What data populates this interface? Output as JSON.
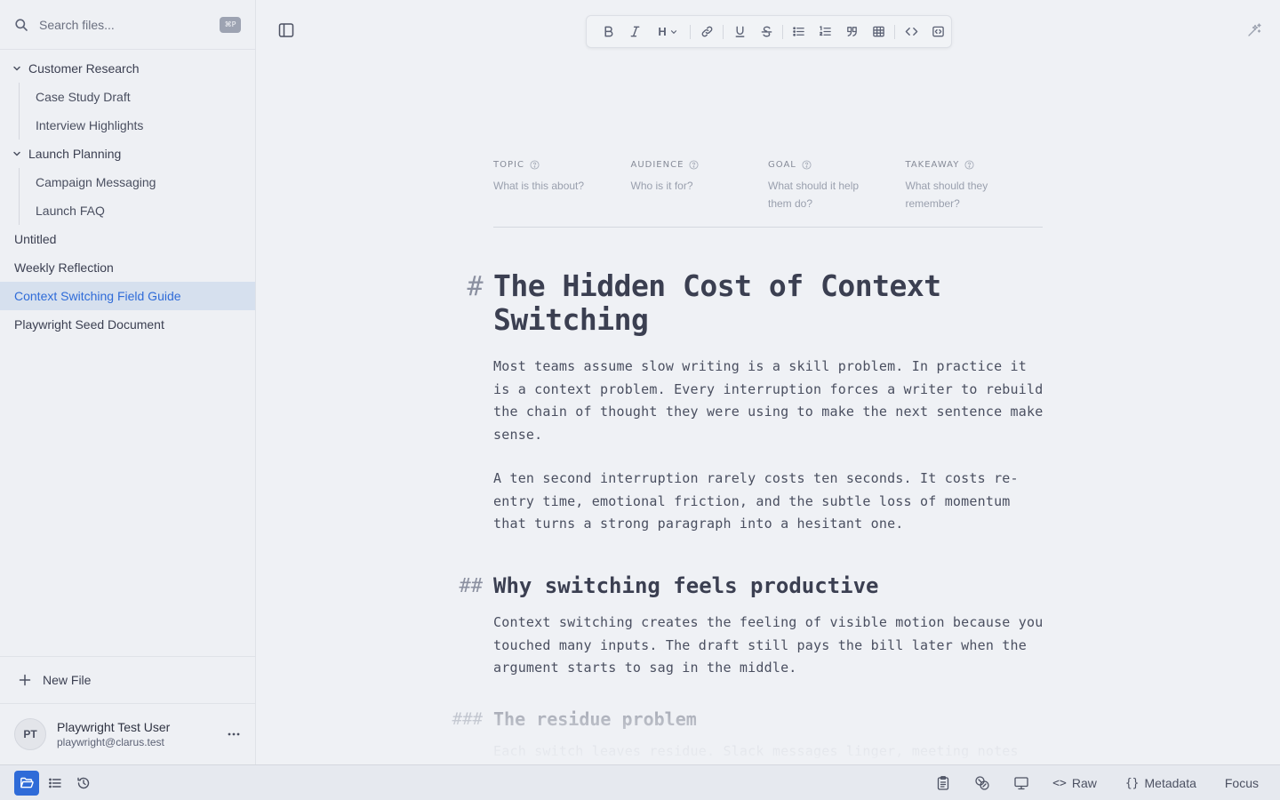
{
  "sidebar": {
    "search_placeholder": "Search files...",
    "search_shortcut": "⌘P",
    "folders": [
      {
        "label": "Customer Research",
        "children": [
          "Case Study Draft",
          "Interview Highlights"
        ]
      },
      {
        "label": "Launch Planning",
        "children": [
          "Campaign Messaging",
          "Launch FAQ"
        ]
      }
    ],
    "files": [
      "Untitled",
      "Weekly Reflection",
      "Context Switching Field Guide",
      "Playwright Seed Document"
    ],
    "active_file": "Context Switching Field Guide",
    "new_file_label": "New File",
    "user": {
      "initials": "PT",
      "name": "Playwright Test User",
      "email": "playwright@clarus.test"
    }
  },
  "toolbar": {
    "buttons": [
      "bold",
      "italic",
      "heading",
      "link",
      "underline",
      "strikethrough",
      "bullet-list",
      "ordered-list",
      "quote",
      "table",
      "code",
      "code-block"
    ],
    "heading_label": "H"
  },
  "metadata": [
    {
      "label": "TOPIC",
      "hint": "What is this about?"
    },
    {
      "label": "AUDIENCE",
      "hint": "Who is it for?"
    },
    {
      "label": "GOAL",
      "hint": "What should it help them do?"
    },
    {
      "label": "TAKEAWAY",
      "hint": "What should they remember?"
    }
  ],
  "document": {
    "h1_marker": "#",
    "h1": "The Hidden Cost of Context Switching",
    "p1": "Most teams assume slow writing is a skill problem. In practice it is a context problem. Every interruption forces a writer to rebuild the chain of thought they were using to make the next sentence make sense.",
    "p2": "A ten second interruption rarely costs ten seconds. It costs re-entry time, emotional friction, and the subtle loss of momentum that turns a strong paragraph into a hesitant one.",
    "h2_marker": "##",
    "h2": "Why switching feels productive",
    "p3": "Context switching creates the feeling of visible motion because you touched many inputs. The draft still pays the bill later when the argument starts to sag in the middle.",
    "h3_marker": "###",
    "h3": "The residue problem",
    "p4": "Each switch leaves residue. Slack messages linger, meeting notes compete for attention, and the draft starts inheriting"
  },
  "statusbar": {
    "raw_label": "Raw",
    "metadata_label": "Metadata",
    "focus_label": "Focus",
    "raw_glyph": "<>",
    "metadata_glyph": "{}"
  },
  "colors": {
    "accent": "#2f6bd8",
    "active_row_bg": "#d6e0ee",
    "background": "#eff1f5"
  }
}
